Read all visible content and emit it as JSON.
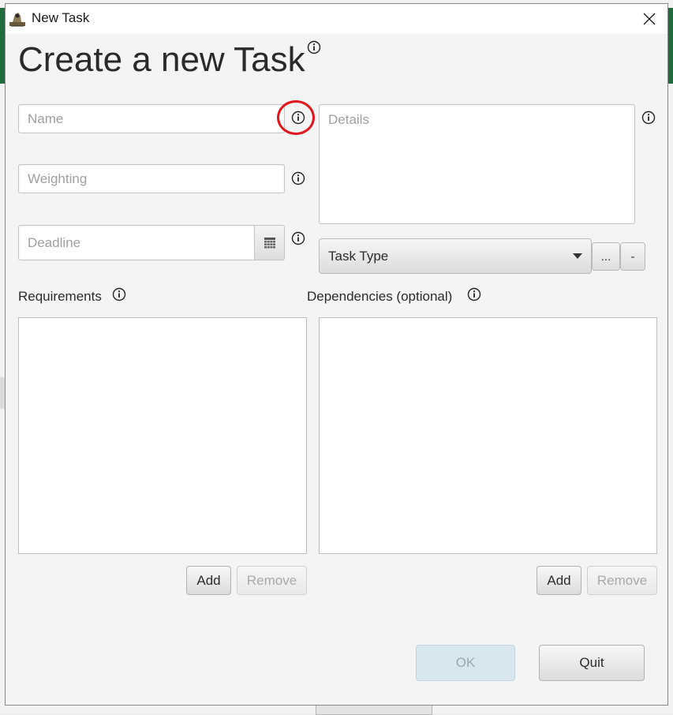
{
  "window": {
    "title": "New Task"
  },
  "heading": "Create a new Task",
  "fields": {
    "name_placeholder": "Name",
    "weighting_placeholder": "Weighting",
    "deadline_placeholder": "Deadline",
    "details_placeholder": "Details"
  },
  "task_type": {
    "selected": "Task Type",
    "more_label": "...",
    "remove_label": "-"
  },
  "requirements": {
    "label": "Requirements",
    "add_label": "Add",
    "remove_label": "Remove"
  },
  "dependencies": {
    "label": "Dependencies (optional)",
    "add_label": "Add",
    "remove_label": "Remove"
  },
  "footer": {
    "ok_label": "OK",
    "quit_label": "Quit"
  },
  "icons": {
    "info": "info-icon",
    "close": "close-icon",
    "calendar": "calendar-icon",
    "dropdown": "chevron-down-icon",
    "app": "app-icon"
  },
  "colors": {
    "highlight_ring": "#e2161d",
    "ok_disabled_bg": "#d8e6ee"
  }
}
